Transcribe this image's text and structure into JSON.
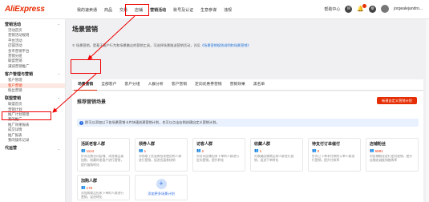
{
  "header": {
    "logo": "AliExpress",
    "nav": [
      "我的速卖通",
      "商品",
      "交易",
      "店铺",
      "营销活动",
      "账号及认证",
      "生意参谋",
      "违规"
    ],
    "active_nav_index": 4,
    "help": "帮助中心",
    "username": "jorgealejandro..."
  },
  "sidebar": {
    "groups": [
      {
        "title": "营销活动",
        "items": [
          "活动首页",
          "营销活动规则",
          "平台活动",
          "店铺活动",
          "金币营销平台",
          "营销分组",
          "联盟营销",
          "满减营销推广"
        ]
      },
      {
        "title": "客户管理与营销",
        "items": [
          "客户管理",
          "客户营销",
          "粉丝营销"
        ]
      },
      {
        "title": "联盟营销",
        "items": [
          "联盟首页",
          "营销计划",
          "推广计划管理",
          "我的推广",
          "推广效果报表",
          "成交详情",
          "推广报表",
          "我的操作记录"
        ]
      },
      {
        "title": "代运营",
        "items": []
      }
    ],
    "active_item": "客户营销"
  },
  "main": {
    "page_title": "场景营销",
    "notice_text": "① 场景营销，是基于客户行为和场景触达的营销工具，可选择场景推送营销活动，详见",
    "notice_link": "《场景营销规则说明和场景营销》",
    "tabs": [
      "场景营销",
      "全部客户",
      "客户分组",
      "人群分析",
      "客户营销",
      "定向优惠券营销",
      "营销效果",
      "黑名单"
    ],
    "active_tab_index": 0,
    "panel_title": "推荐营销场景",
    "create_button": "新建自定义营销计划",
    "tip": "即可以添加以下各场景营销卡片快速创建营销计划，也可以点击右侧创建自定义营销计划。"
  },
  "cards": [
    {
      "title": "活跃老客人群",
      "count": "1113",
      "desc": "针对近期访问店铺、浏览商品或加购、收藏的老客户进行营销，提升复购转化"
    },
    {
      "title": "领券人群",
      "count": "1",
      "desc": "对领取了优惠券但未使用的人群进行营销，促进优惠券核销"
    },
    {
      "title": "访客人群",
      "count": "2",
      "desc": "对访问店铺但未下单的人群进行定向营销，提升转化"
    },
    {
      "title": "收藏人群",
      "count": "1",
      "desc": "对收藏店铺商品的人群进行营销，促进下单转化"
    },
    {
      "title": "待支付订单催付",
      "count": "0",
      "desc": "针对已下单未付款的订单人群进行营销，提升付款率"
    },
    {
      "title": "店铺粉丝",
      "count": "5881",
      "desc": "对店铺粉丝进行定向营销，提升店铺忠诚度和复购率"
    },
    {
      "title": "加购人群",
      "count": "176",
      "desc": "对加购商品但未下单的人群进行营销，促进转化"
    }
  ],
  "add_card": {
    "label": "添加更多场景计划",
    "symbol": "+"
  },
  "colors": {
    "brand": "#e62e04",
    "link": "#1b6fd8",
    "highlight": "#ee0000"
  }
}
